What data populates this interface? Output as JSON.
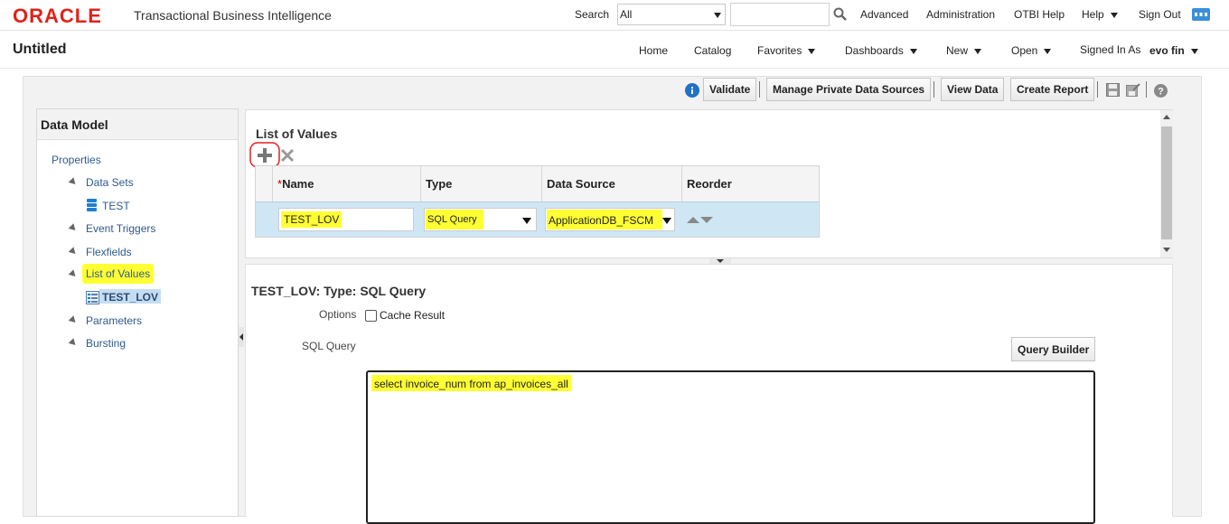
{
  "header": {
    "logo": "ORACLE",
    "product": "Transactional Business Intelligence",
    "search_label": "Search",
    "search_scope": "All",
    "search_value": "",
    "links": [
      "Advanced",
      "Administration",
      "OTBI Help",
      "Help",
      "Sign Out"
    ]
  },
  "page": {
    "title": "Untitled",
    "nav": [
      "Home",
      "Catalog",
      "Favorites",
      "Dashboards",
      "New",
      "Open"
    ],
    "signed_in_label": "Signed In As",
    "user": "evo fin"
  },
  "toolbar": {
    "validate": "Validate",
    "manage_sources": "Manage Private Data Sources",
    "view_data": "View Data",
    "create_report": "Create Report"
  },
  "left_panel": {
    "title": "Data Model",
    "properties": "Properties",
    "data_sets": "Data Sets",
    "data_set_item": "TEST",
    "event_triggers": "Event Triggers",
    "flexfields": "Flexfields",
    "list_of_values": "List of Values",
    "lov_item": "TEST_LOV",
    "parameters": "Parameters",
    "bursting": "Bursting"
  },
  "lov_panel": {
    "title": "List of Values",
    "columns": {
      "name_required": "*",
      "name": "Name",
      "type": "Type",
      "data_source": "Data Source",
      "reorder": "Reorder"
    },
    "row": {
      "name": "TEST_LOV",
      "type": "SQL Query",
      "data_source": "ApplicationDB_FSCM"
    }
  },
  "detail": {
    "title": "TEST_LOV: Type: SQL Query",
    "options_label": "Options",
    "cache_result": "Cache Result",
    "sql_label": "SQL Query",
    "query_builder": "Query Builder",
    "sql_text": "select invoice_num from ap_invoices_all"
  },
  "colors": {
    "oracle_red": "#e0221b",
    "link_blue": "#2d5a8e",
    "highlight": "#ffff33",
    "selected_row": "#cfe6f5"
  }
}
